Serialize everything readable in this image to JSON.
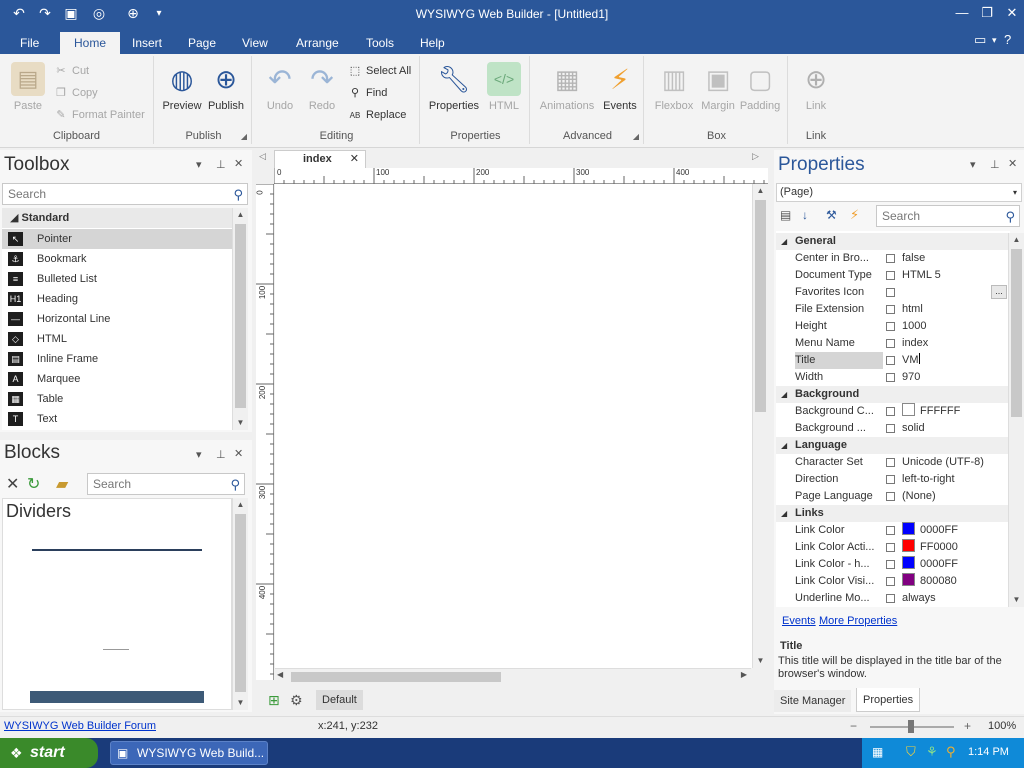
{
  "window": {
    "title": "WYSIWYG Web Builder - [Untitled1]",
    "min_label": "—",
    "max_label": "❐",
    "close_label": "✕"
  },
  "ribbon_tabs": [
    {
      "label": "File"
    },
    {
      "label": "Home"
    },
    {
      "label": "Insert"
    },
    {
      "label": "Page"
    },
    {
      "label": "View"
    },
    {
      "label": "Arrange"
    },
    {
      "label": "Tools"
    },
    {
      "label": "Help"
    }
  ],
  "ribbon": {
    "clipboard": {
      "label": "Clipboard",
      "paste": "Paste",
      "cut": "Cut",
      "copy": "Copy",
      "format_painter": "Format Painter"
    },
    "publish": {
      "label": "Publish",
      "preview": "Preview",
      "publish": "Publish"
    },
    "editing": {
      "label": "Editing",
      "undo": "Undo",
      "redo": "Redo",
      "select_all": "Select All",
      "find": "Find",
      "replace": "Replace"
    },
    "properties": {
      "label": "Properties",
      "properties": "Properties",
      "html": "HTML"
    },
    "advanced": {
      "label": "Advanced",
      "animations": "Animations",
      "events": "Events"
    },
    "box": {
      "label": "Box",
      "flexbox": "Flexbox",
      "margin": "Margin",
      "padding": "Padding"
    },
    "link": {
      "label": "Link",
      "link": "Link"
    }
  },
  "toolbox": {
    "title": "Toolbox",
    "search_placeholder": "Search",
    "category": "Standard",
    "items": [
      {
        "label": "Pointer",
        "icon": "pointer-icon",
        "glyph": "↖"
      },
      {
        "label": "Bookmark",
        "icon": "anchor-icon",
        "glyph": "⚓"
      },
      {
        "label": "Bulleted List",
        "icon": "list-icon",
        "glyph": "≡"
      },
      {
        "label": "Heading",
        "icon": "heading-icon",
        "glyph": "H1"
      },
      {
        "label": "Horizontal Line",
        "icon": "hr-icon",
        "glyph": "—"
      },
      {
        "label": "HTML",
        "icon": "html-icon",
        "glyph": "◇"
      },
      {
        "label": "Inline Frame",
        "icon": "iframe-icon",
        "glyph": "▤"
      },
      {
        "label": "Marquee",
        "icon": "marquee-icon",
        "glyph": "A"
      },
      {
        "label": "Table",
        "icon": "table-icon",
        "glyph": "▦"
      },
      {
        "label": "Text",
        "icon": "text-icon",
        "glyph": "T"
      }
    ]
  },
  "blocks": {
    "title": "Blocks",
    "search_placeholder": "Search",
    "category": "Dividers"
  },
  "editor": {
    "tab": "index",
    "hruler_labels": [
      "0",
      "100",
      "200",
      "300",
      "400"
    ],
    "vruler_labels": [
      "0",
      "100",
      "200",
      "300",
      "400"
    ],
    "bottom_tab": "Default"
  },
  "properties": {
    "title": "Properties",
    "selector": "(Page)",
    "search_placeholder": "Search",
    "groups": [
      {
        "name": "General",
        "rows": [
          {
            "name": "Center in Bro...",
            "value": "false"
          },
          {
            "name": "Document Type",
            "value": "HTML 5"
          },
          {
            "name": "Favorites Icon",
            "value": ""
          },
          {
            "name": "File Extension",
            "value": "html"
          },
          {
            "name": "Height",
            "value": "1000"
          },
          {
            "name": "Menu Name",
            "value": "index"
          },
          {
            "name": "Title",
            "value": "VM"
          },
          {
            "name": "Width",
            "value": "970"
          }
        ]
      },
      {
        "name": "Background",
        "rows": [
          {
            "name": "Background C...",
            "value": "FFFFFF",
            "color": "#FFFFFF"
          },
          {
            "name": "Background ...",
            "value": "solid"
          }
        ]
      },
      {
        "name": "Language",
        "rows": [
          {
            "name": "Character Set",
            "value": "Unicode (UTF-8)"
          },
          {
            "name": "Direction",
            "value": "left-to-right"
          },
          {
            "name": "Page Language",
            "value": "(None)"
          }
        ]
      },
      {
        "name": "Links",
        "rows": [
          {
            "name": "Link Color",
            "value": "0000FF",
            "color": "#0000FF"
          },
          {
            "name": "Link Color Acti...",
            "value": "FF0000",
            "color": "#FF0000"
          },
          {
            "name": "Link Color - h...",
            "value": "0000FF",
            "color": "#0000FF"
          },
          {
            "name": "Link Color Visi...",
            "value": "800080",
            "color": "#800080"
          },
          {
            "name": "Underline Mo...",
            "value": "always"
          }
        ]
      }
    ],
    "events_link": "Events",
    "more_link": "More Properties",
    "desc_title": "Title",
    "desc_text": "This title will be displayed in the title bar of the browser's window.",
    "tab_site_manager": "Site Manager",
    "tab_properties": "Properties"
  },
  "status": {
    "forum_link": "WYSIWYG Web Builder Forum",
    "coords": "x:241, y:232",
    "zoom": "100%"
  },
  "taskbar": {
    "start": "start",
    "task": "WYSIWYG Web Build...",
    "clock": "1:14 PM"
  },
  "colors": {
    "accent": "#2b579a",
    "taskbar": "#1a3b7a",
    "start": "#3a8a2a"
  }
}
